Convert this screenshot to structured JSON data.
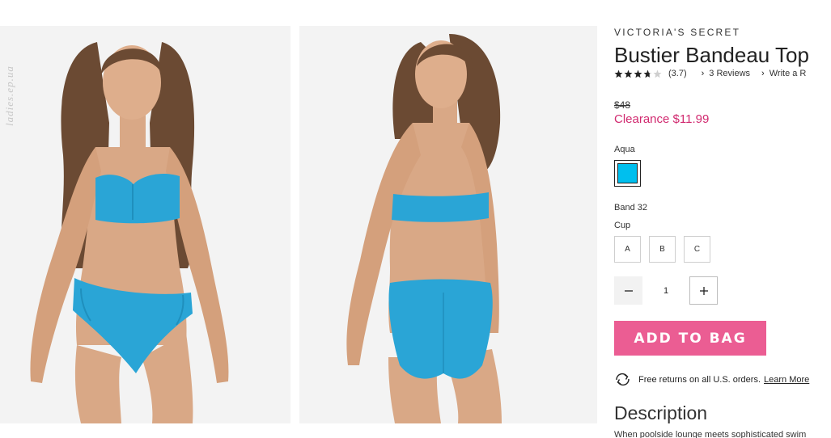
{
  "watermark": "ladies.ep.ua",
  "product": {
    "brand": "VICTORIA'S SECRET",
    "title": "Bustier Bandeau Top",
    "rating_text": "(3.7)",
    "rating_value": 3.7,
    "reviews_link": "3 Reviews",
    "write_review_link": "Write a R",
    "original_price": "$48",
    "sale_price": "Clearance $11.99"
  },
  "options": {
    "color_label": "Aqua",
    "swatch_color": "#00bfee",
    "band_label": "Band 32",
    "cup_label": "Cup",
    "cups": [
      "A",
      "B",
      "C"
    ]
  },
  "quantity": {
    "value": "1"
  },
  "cta": {
    "add_to_bag": "ADD TO BAG",
    "color": "#eb5d93"
  },
  "returns": {
    "text": "Free returns on all U.S. orders.",
    "link": "Learn More"
  },
  "description": {
    "title": "Description",
    "text": "When poolside lounge meets sophisticated swim"
  },
  "colors": {
    "accent": "#d1296f",
    "swimsuit": "#2aa5d6",
    "skin": "#d9a886",
    "hair": "#6b4a33"
  }
}
